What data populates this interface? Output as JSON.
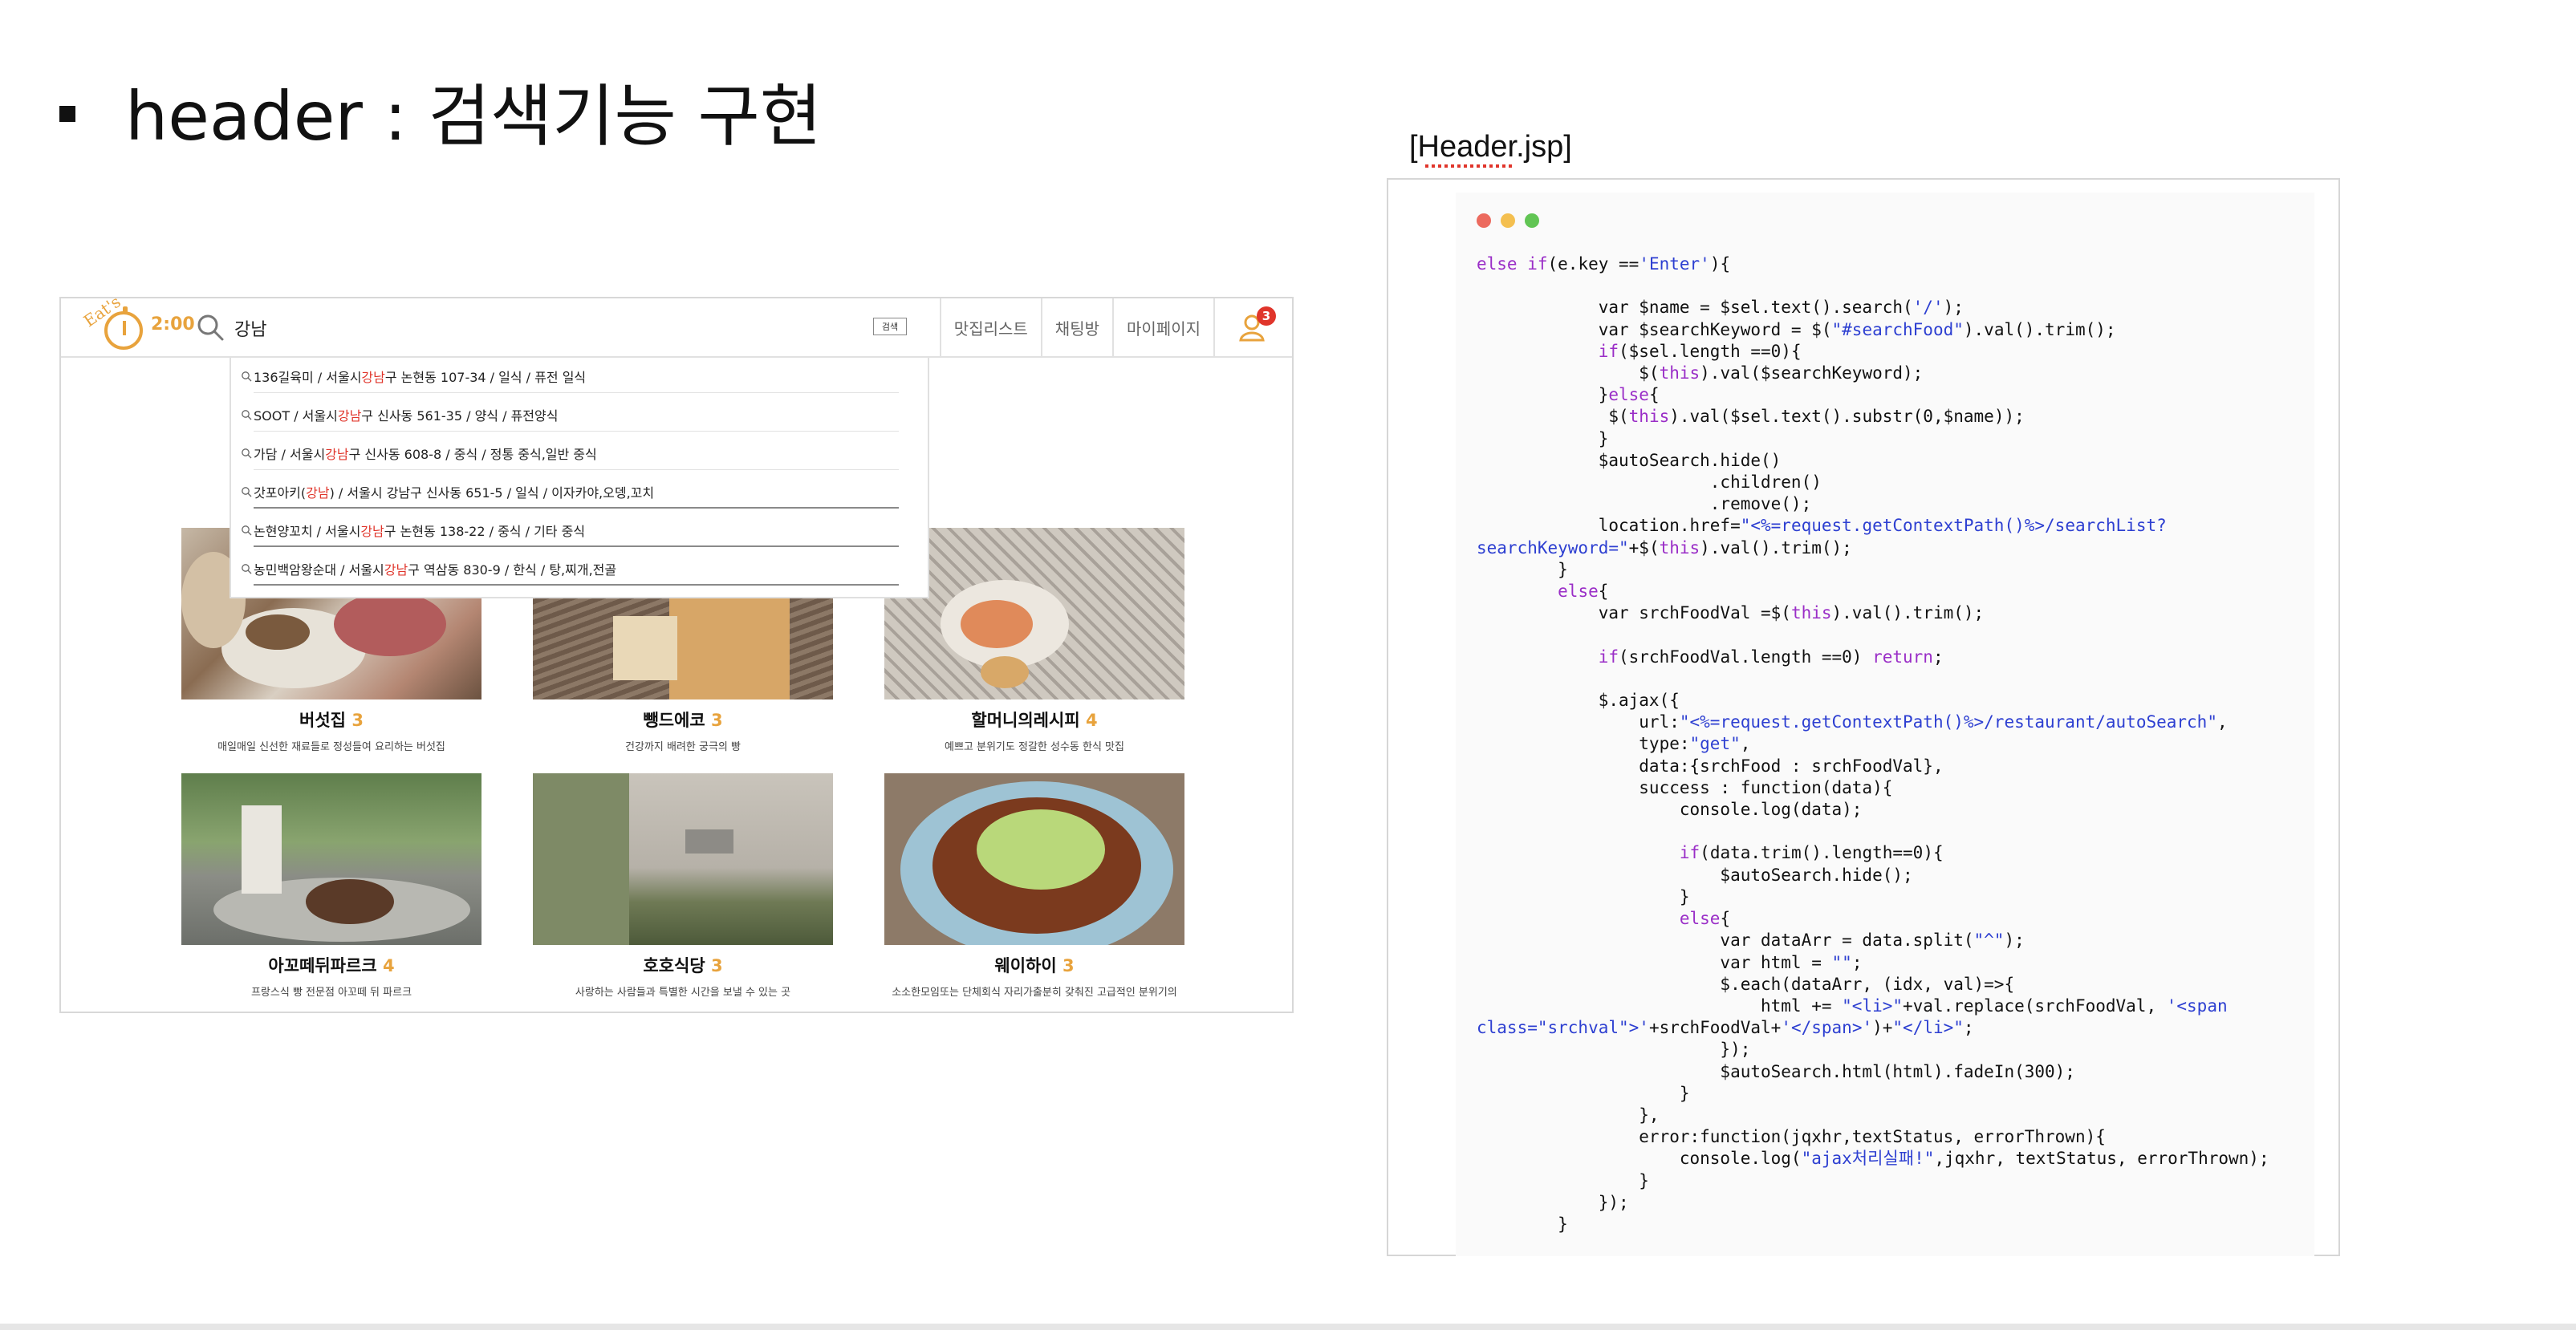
{
  "slide": {
    "title": "header : 검색기능 구현"
  },
  "site": {
    "logo_text": "Eat's",
    "logo_time": "2:00",
    "search_value": "강남",
    "search_button": "검색",
    "nav": [
      "맛집리스트",
      "채팅방",
      "마이페이지"
    ],
    "notification_count": "3",
    "accent_color": "#e8a33d",
    "highlight_color": "#e0352b"
  },
  "autocomplete": [
    {
      "pre": "136길육미  /  서울시 ",
      "hl": "강남",
      "post": "구 논현동 107-34  /  일식  /  퓨전 일식"
    },
    {
      "pre": "SOOT  /  서울시 ",
      "hl": "강남",
      "post": "구 신사동 561-35  /  양식  /  퓨전양식"
    },
    {
      "pre": "가담  /  서울시 ",
      "hl": "강남",
      "post": "구 신사동 608-8  /  중식  /  정통 중식,일반 중식"
    },
    {
      "pre": "갓포아키(",
      "hl": "강남",
      "post": ")  /  서울시 강남구 신사동 651-5  /  일식  /  이자카야,오뎅,꼬치"
    },
    {
      "pre": "논현양꼬치  /  서울시 ",
      "hl": "강남",
      "post": "구 논현동 138-22  /  중식  /  기타 중식"
    },
    {
      "pre": "농민백암왕순대  /  서울시 ",
      "hl": "강남",
      "post": "구 역삼동 830-9  /  한식  /  탕,찌개,전골"
    }
  ],
  "cards": [
    {
      "name": "버섯집",
      "score": "3",
      "desc": "매일매일 신선한 재료들로 정성들여 요리하는 버섯집"
    },
    {
      "name": "뺑드에코",
      "score": "3",
      "desc": "건강까지 배려한 궁극의 빵"
    },
    {
      "name": "할머니의레시피",
      "score": "4",
      "desc": "예쁘고 분위기도 정갈한 성수동 한식 맛집"
    },
    {
      "name": "아꼬떼뒤파르크",
      "score": "4",
      "desc": "프랑스식 빵 전문점 아꼬떼 뒤 파르크"
    },
    {
      "name": "호호식당",
      "score": "3",
      "desc": "사랑하는 사람들과 특별한 시간을 보낼 수 있는 곳"
    },
    {
      "name": "웨이하이",
      "score": "3",
      "desc": "소소한모임또는 단체회식 자리가출분히 갖춰진 고급적인 분위기의"
    }
  ],
  "code_panel": {
    "file_label": "[Header.jsp]",
    "dot_colors": [
      "#ec6a5e",
      "#f4bf4f",
      "#61c554"
    ]
  }
}
